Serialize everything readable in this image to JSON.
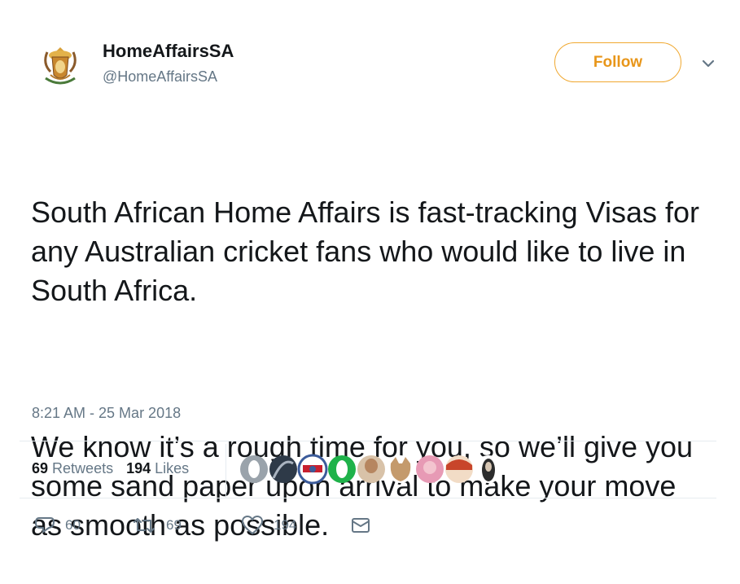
{
  "tweet": {
    "display_name": "HomeAffairsSA",
    "handle": "@HomeAffairsSA",
    "follow_label": "Follow",
    "paragraphs": [
      "South African Home Affairs is fast-tracking Visas for any Australian cricket fans who would like to live in South Africa.",
      "We know it’s a rough time for you, so we’ll give you some sand paper upon arrival to make your move as smooth as possible."
    ],
    "timestamp": "8:21 AM - 25 Mar 2018",
    "retweets_count": "69",
    "retweets_label": "Retweets",
    "likes_count": "194",
    "likes_label": "Likes",
    "liker_avatars": [
      "liker-1",
      "liker-2",
      "liker-3",
      "liker-4",
      "liker-5",
      "liker-6",
      "liker-7",
      "liker-8",
      "liker-9"
    ]
  },
  "actions": {
    "reply_count": "60",
    "retweet_count": "69",
    "like_count": "194"
  },
  "icons": {
    "avatar": "coat-of-arms-icon",
    "caret": "chevron-down-icon",
    "reply": "reply-icon",
    "retweet": "retweet-icon",
    "like": "heart-icon",
    "dm": "envelope-icon"
  },
  "colors": {
    "follow_accent": "#e8961a",
    "text": "#14171a",
    "muted": "#657786",
    "divider": "#e6ecf0"
  }
}
